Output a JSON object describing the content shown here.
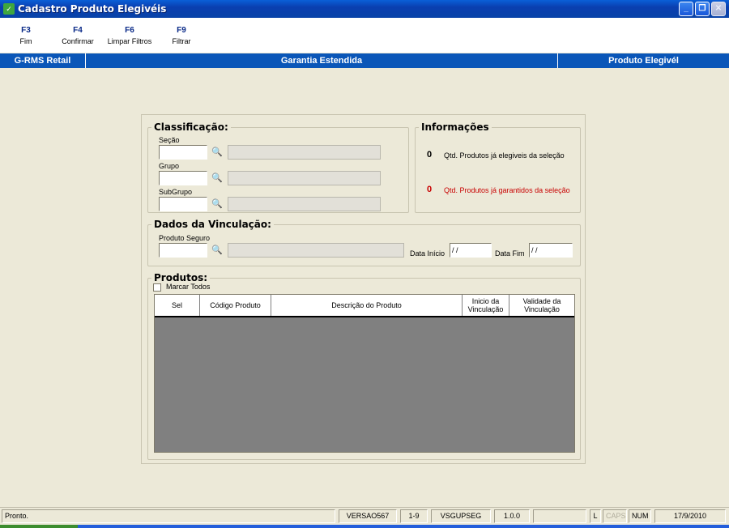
{
  "window": {
    "title": "Cadastro Produto Elegivéis"
  },
  "toolbar": [
    {
      "key": "F3",
      "label": "Fim"
    },
    {
      "key": "F4",
      "label": "Confirmar"
    },
    {
      "key": "F6",
      "label": "Limpar Filtros"
    },
    {
      "key": "F9",
      "label": "Filtrar"
    }
  ],
  "band": {
    "left": "G-RMS Retail",
    "center": "Garantia Estendida",
    "right": "Produto Elegivél"
  },
  "classificacao": {
    "legend": "Classificação:",
    "secao": {
      "label": "Seção",
      "code": "",
      "desc": ""
    },
    "grupo": {
      "label": "Grupo",
      "code": "",
      "desc": ""
    },
    "subgrupo": {
      "label": "SubGrupo",
      "code": "",
      "desc": ""
    }
  },
  "informacoes": {
    "legend": "Informações",
    "elegiveis_count": "0",
    "elegiveis_text": "Qtd. Produtos já elegiveis da seleção",
    "garantidos_count": "0",
    "garantidos_text": "Qtd. Produtos já garantidos da seleção"
  },
  "vinculacao": {
    "legend": "Dados da Vinculação:",
    "produto_label": "Produto Seguro",
    "produto_code": "",
    "produto_desc": "",
    "data_inicio_label": "Data Início",
    "data_inicio_value": " / /",
    "data_fim_label": "Data Fim",
    "data_fim_value": " / /"
  },
  "produtos": {
    "legend": "Produtos:",
    "marcar_todos": "Marcar Todos",
    "columns": [
      "Sel",
      "Código Produto",
      "Descrição do Produto",
      "Inicio da Vinculação",
      "Validade da Vinculação"
    ]
  },
  "status": {
    "message": "Pronto.",
    "versao": "VERSAO567",
    "range": "1-9",
    "module": "VSGUPSEG",
    "version_num": "1.0.0",
    "l": "L",
    "caps": "CAPS",
    "num": "NUM",
    "date": "17/9/2010"
  },
  "icons": {
    "binoculars": "binoculars-icon"
  },
  "colors": {
    "band": "#0a56b8",
    "warning": "#c80000",
    "grid_bg": "#808080"
  }
}
